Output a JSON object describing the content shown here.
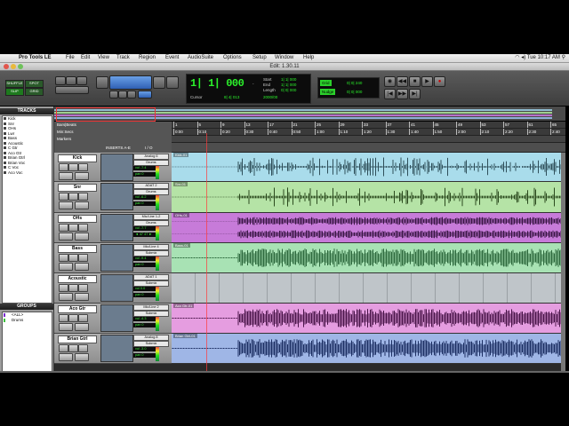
{
  "menubar": {
    "apple_glyph": "",
    "app_name": "Pro Tools LE",
    "items": [
      "File",
      "Edit",
      "View",
      "Track",
      "Region",
      "Event",
      "AudioSuite",
      "Options",
      "Setup",
      "Window",
      "Help"
    ],
    "clock": "Tue 10:17 AM"
  },
  "window": {
    "title": "Edit: 1.30.11"
  },
  "toolbar": {
    "modes": [
      "SHUFFLE",
      "SPOT",
      "SLIP",
      "GRID"
    ],
    "counter": {
      "main": "1| 1| 000",
      "main_unit": "-",
      "start_label": "Start",
      "end_label": "End",
      "length_label": "Length",
      "start_value": "1| 1| 000",
      "end_value": "1| 1| 000",
      "length_value": "0| 0| 000",
      "cursor_label": "Cursor",
      "cursor_value": "8| 4| 013",
      "sample_label": "",
      "sample_value": "2000/00"
    },
    "grid_label": "Grid",
    "grid_value": "0| 0| 240",
    "nudge_label": "Nudge",
    "nudge_value": "0| 0| 000"
  },
  "left_panel": {
    "tracks_header": "TRACKS",
    "tracks": [
      "Kick",
      "Snr",
      "OHs",
      "Lwr",
      "Bass",
      "Acoustic",
      "C Gtr",
      "Aco Gtr",
      "Brian Gtrl",
      "Brian Voc",
      "C Voc",
      "Aco Voc"
    ],
    "groups_header": "GROUPS",
    "groups": [
      {
        "name": "<ALL>",
        "color": "#7a2bd0"
      },
      {
        "name": "Drums",
        "color": "#3ac03a"
      }
    ]
  },
  "rulers": {
    "labels": [
      "Bars|Beats",
      "Min:Secs",
      "Markers"
    ],
    "bar_ticks": [
      "1",
      "5",
      "9",
      "13",
      "17",
      "21",
      "25",
      "29",
      "33",
      "37",
      "41",
      "45",
      "49",
      "53",
      "57",
      "61",
      "65"
    ],
    "min_ticks": [
      "0:00",
      "0:10",
      "0:20",
      "0:30",
      "0:40",
      "0:50",
      "1:00",
      "1:10",
      "1:20",
      "1:30",
      "1:40",
      "1:50",
      "2:00",
      "2:10",
      "2:20",
      "2:30",
      "2:40"
    ]
  },
  "header_columns": {
    "inserts": "INSERTS A-E",
    "io": "I / O"
  },
  "tracks": [
    {
      "name": "Kick",
      "io_in": "Analog 6",
      "io_out": "Drums",
      "vol": "vol -7.4",
      "pan": "pan  0",
      "clip": "Kick-01",
      "color": "#a9dceb",
      "wave": "#2f4f5a",
      "mode": "sparse"
    },
    {
      "name": "Snr",
      "io_in": "ADAT 2",
      "io_out": "Drums",
      "vol": "vol -6.2",
      "pan": "pan  0",
      "clip": "Snr-01",
      "color": "#b5e3a6",
      "wave": "#2b4a1e",
      "mode": "spiky"
    },
    {
      "name": "OHs",
      "io_in": "Mic/Line 1-2",
      "io_out": "Drums",
      "vol": "vol -7.7",
      "pan": "◄ 47  47 ►",
      "clip": "OHs-01",
      "color": "#c77bd9",
      "wave": "#3a1645",
      "mode": "stereo"
    },
    {
      "name": "Bass",
      "io_in": "Mic/Line 4",
      "io_out": "Submix",
      "vol": "vol -9.4",
      "pan": "pan  0",
      "clip": "Bass-01",
      "color": "#a8e2b4",
      "wave": "#2e6a3e",
      "mode": "dense"
    },
    {
      "name": "Acoustic",
      "io_in": "ADAT 1",
      "io_out": "Submix",
      "vol": "vol  0.0",
      "pan": "pan  0",
      "clip": "",
      "color": "#bfc5c9",
      "wave": "#555",
      "mode": "none"
    },
    {
      "name": "Aco Gtr",
      "io_in": "Mic/Line 2",
      "io_out": "Submix",
      "vol": "vol -4.3",
      "pan": "pan  0",
      "clip": "Aco Gtr-01",
      "color": "#e59de0",
      "wave": "#4a154a",
      "mode": "dense"
    },
    {
      "name": "Brian Gtrl",
      "io_in": "Analog 8",
      "io_out": "Submix",
      "vol": "vol -3.0",
      "pan": "pan  0",
      "clip": "Brian Gtrl-01",
      "color": "#9fb6e6",
      "wave": "#1c2f63",
      "mode": "dense"
    }
  ]
}
